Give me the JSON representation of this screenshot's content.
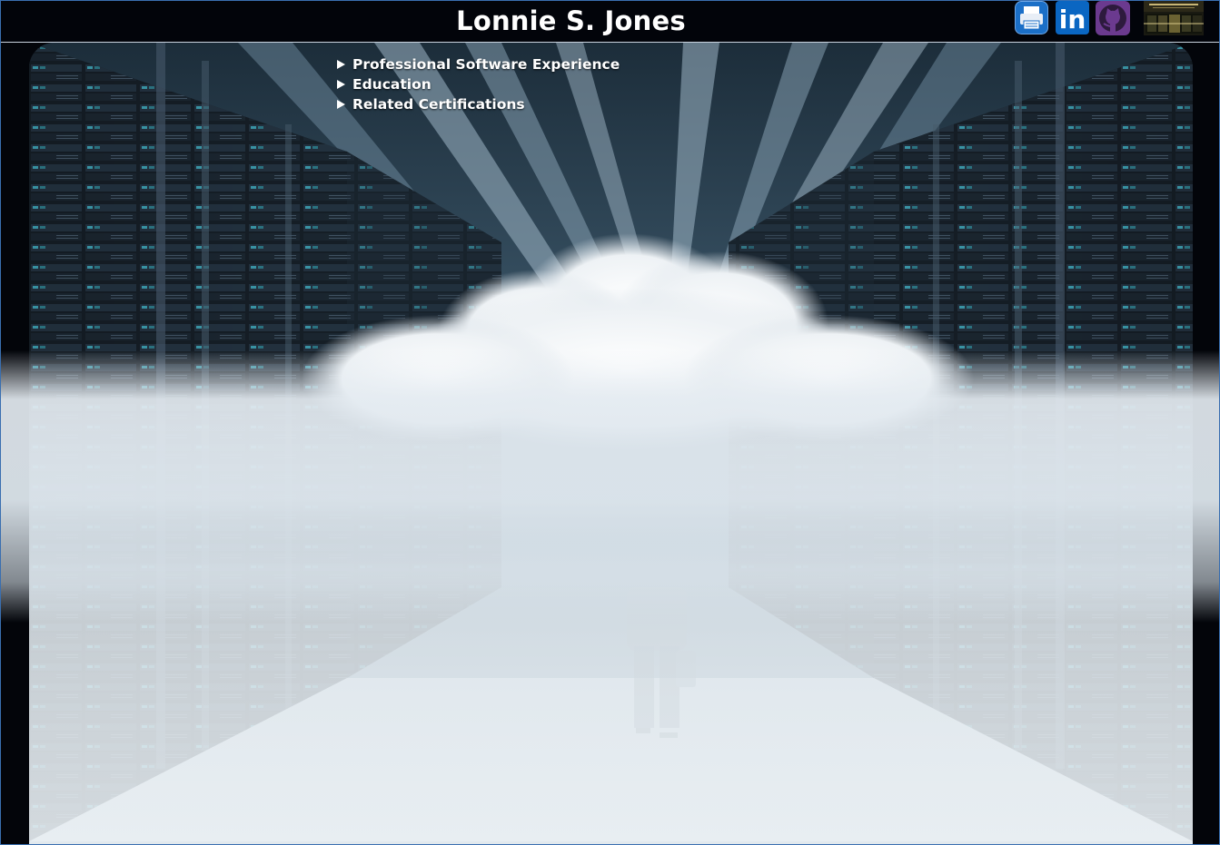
{
  "header": {
    "title": "Lonnie S. Jones"
  },
  "icons": [
    {
      "name": "print-icon"
    },
    {
      "name": "linkedin-icon",
      "text": "in"
    },
    {
      "name": "github-icon"
    },
    {
      "name": "profile-thumbnail"
    }
  ],
  "menu": {
    "items": [
      {
        "label": "Professional Software Experience"
      },
      {
        "label": "Education"
      },
      {
        "label": "Related Certifications"
      }
    ]
  },
  "colors": {
    "page_background": "#03050a",
    "header_background": "#02040a",
    "frame_border": "#3a6fb0",
    "linkedin_blue": "#0a66c2",
    "print_blue": "#1b6fc7",
    "github_purple": "#6b3a8f"
  }
}
